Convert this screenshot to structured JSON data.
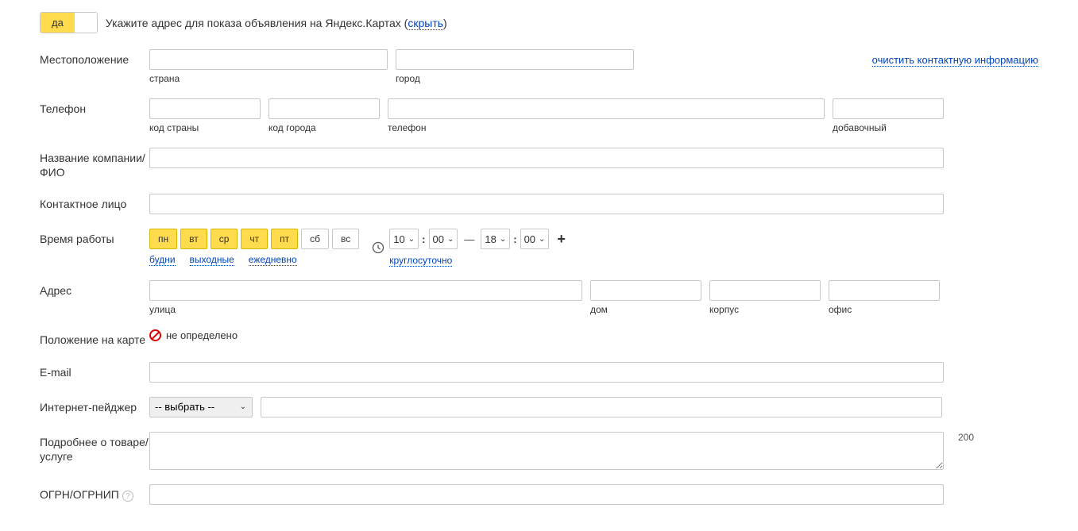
{
  "toggle": {
    "yes": "да"
  },
  "top_text": {
    "prefix": "Укажите адрес для показа объявления на Яндекс.Картах (",
    "hide": "скрыть",
    "suffix": ")"
  },
  "labels": {
    "location": "Местоположение",
    "phone": "Телефон",
    "company": "Название компании/ФИО",
    "contact": "Контактное лицо",
    "hours": "Время работы",
    "address": "Адрес",
    "map_pos": "Положение на карте",
    "email": "E-mail",
    "pager": "Интернет-пейджер",
    "details": "Подробнее о товаре/услуге",
    "ogrn": "ОГРН/ОГРНИП"
  },
  "clear_link": "очистить контактную информацию",
  "sublabels": {
    "country": "страна",
    "city": "город",
    "country_code": "код страны",
    "city_code": "код города",
    "phone": "телефон",
    "ext": "добавочный",
    "street": "улица",
    "house": "дом",
    "building": "корпус",
    "office": "офис"
  },
  "days": {
    "mon": "пн",
    "tue": "вт",
    "wed": "ср",
    "thu": "чт",
    "fri": "пт",
    "sat": "сб",
    "sun": "вс"
  },
  "quick": {
    "weekdays": "будни",
    "weekend": "выходные",
    "daily": "ежедневно",
    "allday": "круглосуточно"
  },
  "time": {
    "h1": "10",
    "m1": "00",
    "h2": "18",
    "m2": "00",
    "colon": ":",
    "dash": "—",
    "plus": "+"
  },
  "map_status": "не определено",
  "pager_select": "-- выбрать --",
  "details_count": "200",
  "help_q": "?"
}
